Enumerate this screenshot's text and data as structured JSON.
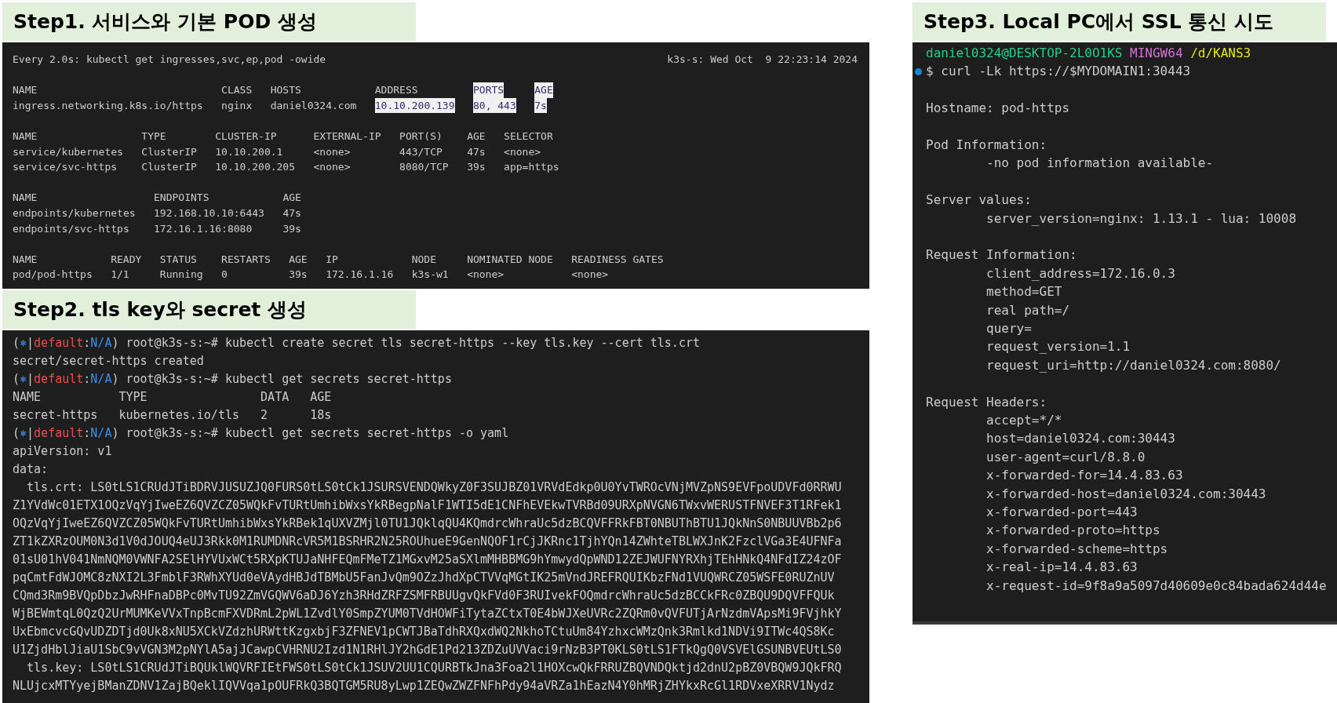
{
  "left_column": [
    {
      "kind": "watch",
      "title": "Step1. 서비스와 기본 POD 생성",
      "command": "Every 2.0s: kubectl get ingresses,svc,ep,pod -owide",
      "status": "k3s-s: Wed Oct  9 22:23:14 2024",
      "tables": [
        {
          "header": [
            "NAME",
            "CLASS",
            "HOSTS",
            "ADDRESS",
            {
              "text": "PORTS",
              "highlighted": true
            },
            {
              "text": "AGE",
              "highlighted": true
            }
          ],
          "rows": [
            [
              "ingress.networking.k8s.io/https",
              "nginx",
              "daniel0324.com",
              {
                "text": "10.10.200.139",
                "highlighted": true
              },
              {
                "text": "80, 443",
                "highlighted": true
              },
              {
                "text": "7s",
                "highlighted": true
              }
            ]
          ]
        },
        {
          "header": [
            "NAME",
            "TYPE",
            "CLUSTER-IP",
            "EXTERNAL-IP",
            "PORT(S)",
            "AGE",
            "SELECTOR"
          ],
          "rows": [
            [
              "service/kubernetes",
              "ClusterIP",
              "10.10.200.1",
              "<none>",
              "443/TCP",
              "47s",
              "<none>"
            ],
            [
              "service/svc-https",
              "ClusterIP",
              "10.10.200.205",
              "<none>",
              "8080/TCP",
              "39s",
              "app=https"
            ]
          ]
        },
        {
          "header": [
            "NAME",
            "ENDPOINTS",
            "AGE"
          ],
          "rows": [
            [
              "endpoints/kubernetes",
              "192.168.10.10:6443",
              "47s"
            ],
            [
              "endpoints/svc-https",
              "172.16.1.16:8080",
              "39s"
            ]
          ]
        },
        {
          "header": [
            "NAME",
            "READY",
            "STATUS",
            "RESTARTS",
            "AGE",
            "IP",
            "NODE",
            "NOMINATED NODE",
            "READINESS GATES"
          ],
          "rows": [
            [
              "pod/pod-https",
              "1/1",
              "Running",
              "0",
              "39s",
              "172.16.1.16",
              "k3s-w1",
              "<none>",
              "<none>"
            ]
          ]
        }
      ]
    },
    {
      "kind": "shell",
      "title": "Step2. tls key와 secret 생성",
      "lines": [
        {
          "kind": "prompt",
          "segments": [
            {
              "text": "("
            },
            {
              "text": "⎈",
              "color": "#3b8eea"
            },
            {
              "text": "|"
            },
            {
              "text": "default",
              "color": "#f14c4c"
            },
            {
              "text": ":"
            },
            {
              "text": "N/A",
              "color": "#3b8eea"
            },
            {
              "text": ") root@k3s-s:~# kubectl create secret tls secret-https --key tls.key --cert tls.crt"
            }
          ]
        },
        {
          "kind": "output",
          "text": "secret/secret-https created"
        },
        {
          "kind": "prompt",
          "segments": [
            {
              "text": "("
            },
            {
              "text": "⎈",
              "color": "#3b8eea"
            },
            {
              "text": "|"
            },
            {
              "text": "default",
              "color": "#f14c4c"
            },
            {
              "text": ":"
            },
            {
              "text": "N/A",
              "color": "#3b8eea"
            },
            {
              "text": ") root@k3s-s:~# kubectl get secrets secret-https"
            }
          ]
        },
        {
          "kind": "output",
          "text": "NAME           TYPE                DATA   AGE"
        },
        {
          "kind": "output",
          "text": "secret-https   kubernetes.io/tls   2      18s"
        },
        {
          "kind": "prompt",
          "segments": [
            {
              "text": "("
            },
            {
              "text": "⎈",
              "color": "#3b8eea"
            },
            {
              "text": "|"
            },
            {
              "text": "default",
              "color": "#f14c4c"
            },
            {
              "text": ":"
            },
            {
              "text": "N/A",
              "color": "#3b8eea"
            },
            {
              "text": ") root@k3s-s:~# kubectl get secrets secret-https -o yaml"
            }
          ]
        },
        {
          "kind": "output",
          "text": "apiVersion: v1"
        },
        {
          "kind": "output",
          "text": "data:"
        },
        {
          "kind": "output",
          "text": "  tls.crt: LS0tLS1CRUdJTiBDRVJUSUZJQ0FURS0tLS0tCk1JSURSVENDQWkyZ0F3SUJBZ01VRVdEdkp0U0YvTWROcVNjMVZpNS9EVFpoUDVFd0RRWU"
        },
        {
          "kind": "output",
          "text": "Z1YVdWc01ETX1OQzVqYjIweEZ6QVZCZ05WQkFvTURtUmhibWxsYkRBegpNalF1WTI5dE1CNFhEVEkwTVRBd09URXpNVGN6TWxvWERUSTFNVEF3T1RFek1"
        },
        {
          "kind": "output",
          "text": "OQzVqYjIweEZ6QVZCZ05WQkFvTURtUmhibWxsYkRBek1qUXVZMjl0TU1JQklqQU4KQmdrcWhraUc5dzBCQVFFRkFBT0NBUThBTU1JQkNnS0NBUUVBb2p6"
        },
        {
          "kind": "output",
          "text": "ZT1kZXRzOUM0N3d1V0dJOUQ4eUJ3Rkk0M1RUMDNRcVR5M1BSRHR2N25ROUhueE9GenNQOF1rCjJKRnc1TjhYQn14ZWhteTBLWXJnK2FzclVGa3E4UFNFa"
        },
        {
          "kind": "output",
          "text": "01sU01hV041NmNQM0VWNFA2SElHYVUxWCt5RXpKTUJaNHFEQmFMeTZ1MGxvM25aSXlmMHBBMG9hYmwydQpWND12ZEJWUFNYRXhjTEhHNkQ4NFdIZ24zOF"
        },
        {
          "kind": "output",
          "text": "pqCmtFdWJOMC8zNXI2L3FmblF3RWhXYUd0eVAydHBJdTBMbU5FanJvQm9OZzJhdXpCTVVqMGtIK25mVndJREFRQUIKbzFNd1VUQWRCZ05WSFE0RUZnUV"
        },
        {
          "kind": "output",
          "text": "CQmd3Rm9BVQpDbzJwRHFnaDBPc0MvTU92ZmVGQWV6aDJ6Yzh3RHdZRFZSMFRBUUgvQkFVd0F3RUIvekFOQmdrcWhraUc5dzBCCkFRc0ZBQU9DQVFFQUk"
        },
        {
          "kind": "output",
          "text": "WjBEWmtqL0QzQ2UrMUMKeVVxTnpBcmFXVDRmL2pWL1ZvdlY0SmpZYUM0TVdHOWFiTytaZCtxT0E4bWJXeUVRc2ZQRm0vQVFUTjArNzdmVApsMi9FVjhkY"
        },
        {
          "kind": "output",
          "text": "UxEbmcvcGQvUDZDTjd0Uk8xNU5XCkVZdzhURWttKzgxbjF3ZFNEV1pCWTJBaTdhRXQxdWQ2NkhoTCtuUm84YzhxcWMzQnk3Rmlkd1NDVi9ITWc4QS8Kc"
        },
        {
          "kind": "output",
          "text": "U1ZjdHblJiaU1SbC9vVGN3M2pNYlA5ajJCawpCVHRNU2Izd1N1RHlJY2hGdE1Pd213ZDZuUVVaci9rNzB3PT0KLS0tLS1FTkQgQ0VSVElGSUNBVEUtLS0"
        },
        {
          "kind": "output",
          "text": "  tls.key: LS0tLS1CRUdJTiBQUklWQVRFIEtFWS0tLS0tCk1JSUV2UU1CQURBTkJna3Foa2l1HOXcwQkFRRUZBQVNDQktjd2dnU2pBZ0VBQW9JQkFRQ"
        },
        {
          "kind": "output",
          "text": "NLUjcxMTYyejBManZDNV1ZajBQeklIQVVqa1pOUFRkQ3BQTGM5RU8yLwp1ZEQwZWZFNFhPdy94aVRZa1hEazN4Y0hMRjZHYkxRcGl1RDVxeXRRV1Nydz"
        }
      ]
    }
  ],
  "right_column": [
    {
      "kind": "bash",
      "title": "Step3. Local PC에서 SSL 통신 시도",
      "blocks": [
        [
          {
            "segments": [
              {
                "text": "daniel0324@DESKTOP-2L0O1KS",
                "color": "#23d18b"
              },
              {
                "text": "MINGW64",
                "color": "#d670d6"
              },
              {
                "text": "/d/KANS3",
                "color": "#e5e510"
              }
            ],
            "marker": false
          },
          {
            "segments": [
              {
                "text": "$ curl -Lk https://$MYDOMAIN1:30443"
              }
            ],
            "marker": true
          }
        ],
        [
          {
            "text": "Hostname: pod-https",
            "indent": false
          }
        ],
        [
          {
            "text": "Pod Information:",
            "indent": false
          },
          {
            "text": "-no pod information available-",
            "indent": true
          }
        ],
        [
          {
            "text": "Server values:",
            "indent": false
          },
          {
            "text": "server_version=nginx: 1.13.1 - lua: 10008",
            "indent": true
          }
        ],
        [
          {
            "text": "Request Information:",
            "indent": false
          },
          {
            "text": "client_address=172.16.0.3",
            "indent": true
          },
          {
            "text": "method=GET",
            "indent": true
          },
          {
            "text": "real path=/",
            "indent": true
          },
          {
            "text": "query=",
            "indent": true
          },
          {
            "text": "request_version=1.1",
            "indent": true
          },
          {
            "text": "request_uri=http://daniel0324.com:8080/",
            "indent": true
          }
        ],
        [
          {
            "text": "Request Headers:",
            "indent": false
          },
          {
            "text": "accept=*/*",
            "indent": true
          },
          {
            "text": "host=daniel0324.com:30443",
            "indent": true
          },
          {
            "text": "user-agent=curl/8.8.0",
            "indent": true
          },
          {
            "text": "x-forwarded-for=14.4.83.63",
            "indent": true
          },
          {
            "text": "x-forwarded-host=daniel0324.com:30443",
            "indent": true
          },
          {
            "text": "x-forwarded-port=443",
            "indent": true
          },
          {
            "text": "x-forwarded-proto=https",
            "indent": true
          },
          {
            "text": "x-forwarded-scheme=https",
            "indent": true
          },
          {
            "text": "x-real-ip=14.4.83.63",
            "indent": true
          },
          {
            "text": "x-request-id=9f8a9a5097d40609e0c84bada624d44e",
            "indent": true
          }
        ]
      ]
    }
  ]
}
